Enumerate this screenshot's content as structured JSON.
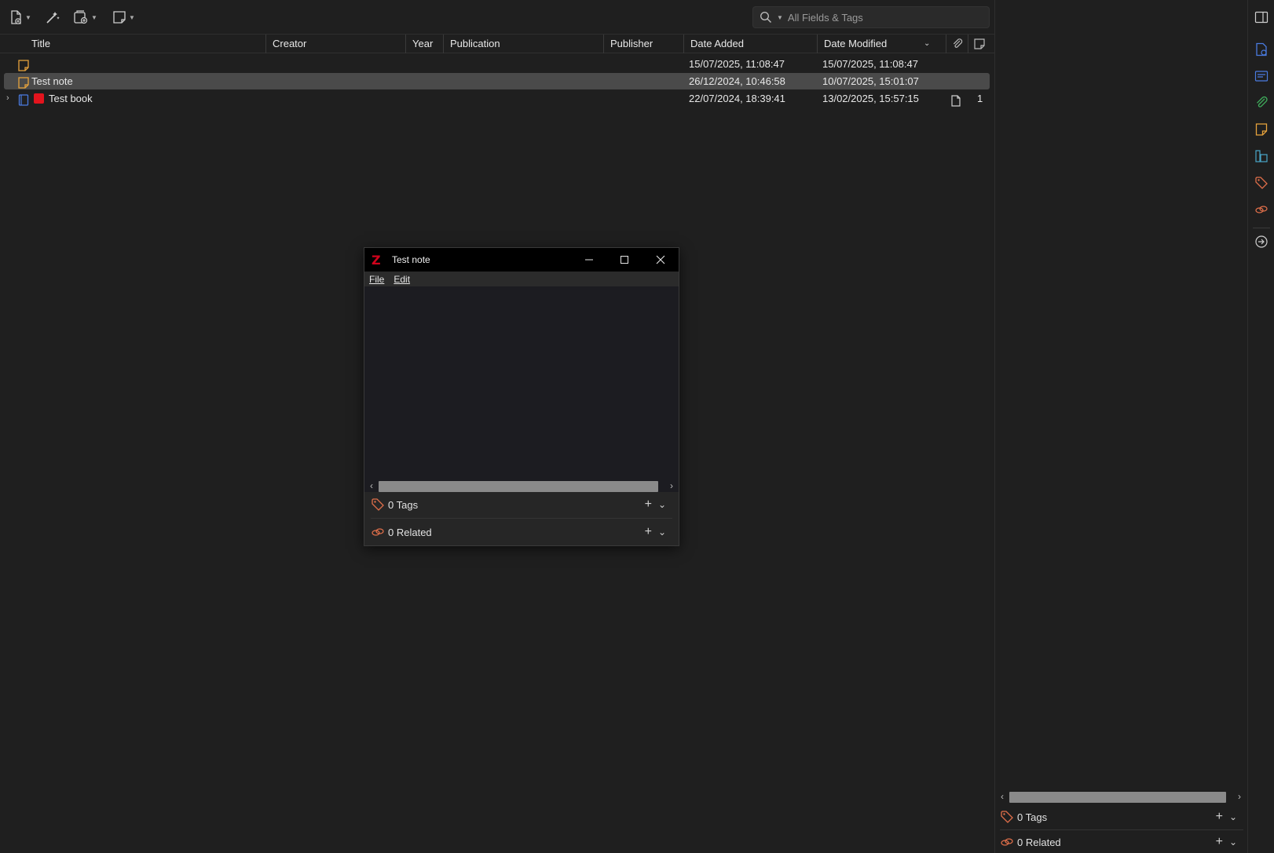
{
  "toolbar": {
    "new_item_icon": "new-item-icon",
    "magic_wand_icon": "add-by-identifier-icon",
    "add_attachment_icon": "add-attachment-icon",
    "new_note_icon": "new-note-icon"
  },
  "search": {
    "placeholder": "All Fields & Tags",
    "mode_icon": "search-icon"
  },
  "columns": {
    "title": "Title",
    "creator": "Creator",
    "year": "Year",
    "publication": "Publication",
    "publisher": "Publisher",
    "date_added": "Date Added",
    "date_modified": "Date Modified"
  },
  "rows": [
    {
      "title": "",
      "date_added": "15/07/2025, 11:08:47",
      "date_modified": "15/07/2025, 11:08:47",
      "type_icon": "note-icon"
    },
    {
      "title": "Test note",
      "date_added": "26/12/2024, 10:46:58",
      "date_modified": "10/07/2025, 15:01:07",
      "type_icon": "note-icon",
      "selected": true
    },
    {
      "title": "Test book",
      "date_added": "22/07/2024, 18:39:41",
      "date_modified": "13/02/2025, 15:57:15",
      "type_icon": "book-icon",
      "color_tag": "#e3141d",
      "attachments": "1"
    }
  ],
  "note_window": {
    "title": "Test note",
    "menu": {
      "file": "File",
      "edit": "Edit"
    },
    "tags_label": "0 Tags",
    "related_label": "0 Related"
  },
  "item_pane": {
    "tags_label": "0 Tags",
    "related_label": "0 Related"
  },
  "colors": {
    "background": "#1f1f1f",
    "selected_row": "#4a4a4a",
    "note_icon": "#e8a33c",
    "book_icon": "#4a7be0",
    "tag_icon": "#e06f4a",
    "attachment_icon": "#3fae5c",
    "zotero_red": "#d0021b"
  }
}
